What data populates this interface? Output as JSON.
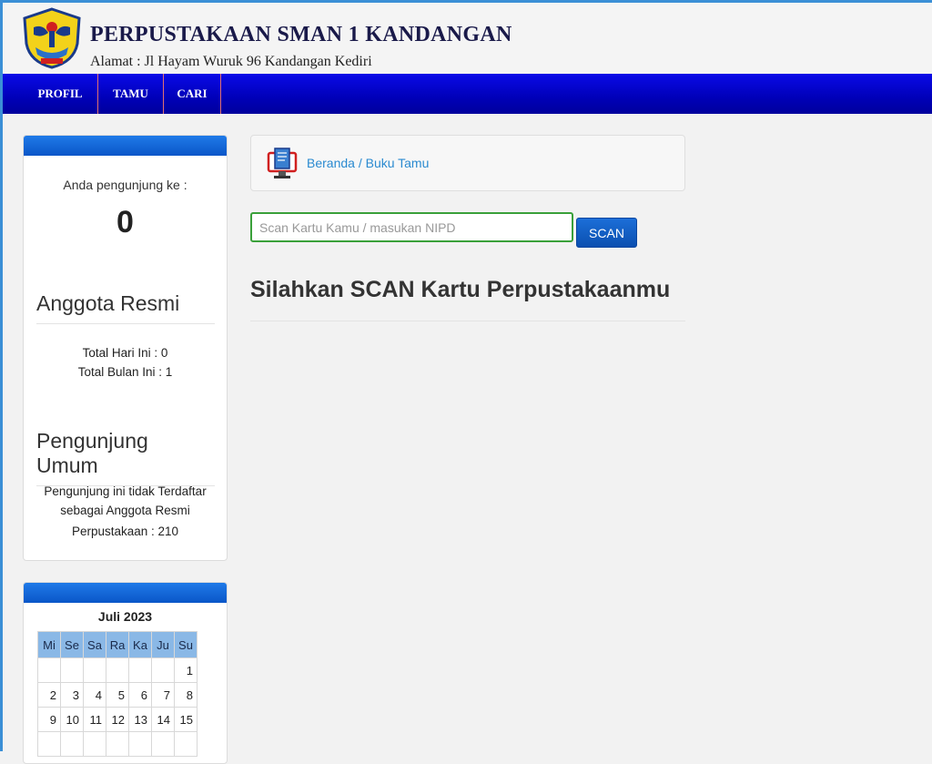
{
  "header": {
    "title": "PERPUSTAKAAN SMAN 1 KANDANGAN",
    "address": "Alamat : Jl Hayam Wuruk 96 Kandangan Kediri"
  },
  "nav": {
    "items": [
      {
        "label": "PROFIL"
      },
      {
        "label": "TAMU"
      },
      {
        "label": "CARI"
      }
    ]
  },
  "sidebar": {
    "visitor_label": "Anda pengunjung ke :",
    "visitor_count": "0",
    "official": {
      "title": "Anggota Resmi",
      "today": "Total Hari Ini : 0",
      "month": "Total Bulan Ini : 1"
    },
    "general": {
      "title": "Pengunjung Umum",
      "line1": "Pengunjung ini tidak Terdaftar",
      "line2": "sebagai Anggota Resmi",
      "line3": "Perpustakaan : 210"
    }
  },
  "calendar": {
    "month": "Juli 2023",
    "days": [
      "Mi",
      "Se",
      "Sa",
      "Ra",
      "Ka",
      "Ju",
      "Su"
    ],
    "weeks": [
      [
        "",
        "",
        "",
        "",
        "",
        "",
        "1"
      ],
      [
        "2",
        "3",
        "4",
        "5",
        "6",
        "7",
        "8"
      ],
      [
        "9",
        "10",
        "11",
        "12",
        "13",
        "14",
        "15"
      ],
      [
        "",
        "",
        "",
        "",
        "",
        "",
        ""
      ]
    ]
  },
  "main": {
    "breadcrumb": "Beranda / Buku Tamu",
    "search_placeholder": "Scan Kartu Kamu / masukan NIPD",
    "search_value": "",
    "scan_label": "SCAN",
    "heading": "Silahkan SCAN Kartu Perpustakaanmu"
  },
  "colors": {
    "nav": "#0000c0",
    "accent": "#0b5fd0",
    "input_border": "#3aa03a",
    "link": "#2a8ad0"
  }
}
